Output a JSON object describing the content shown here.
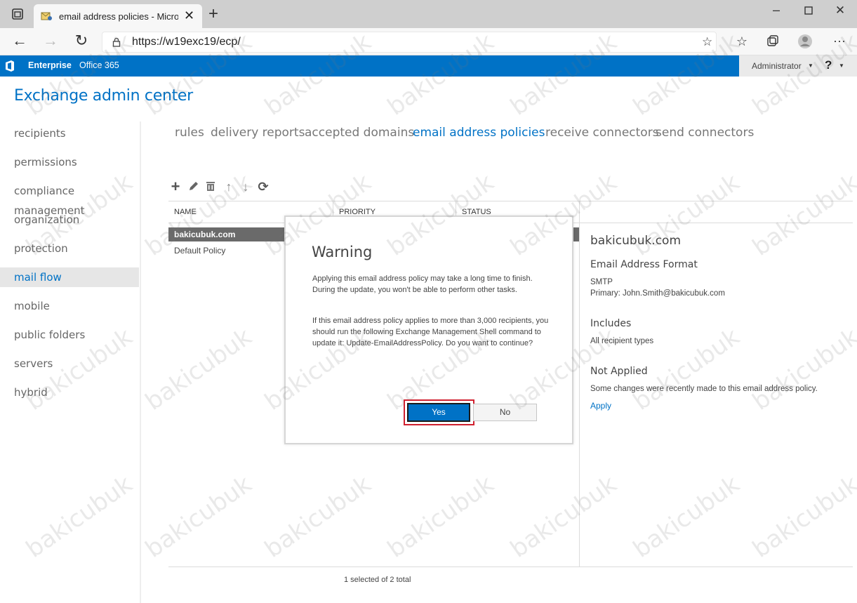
{
  "browser": {
    "tab_title": "email address policies - Microsof",
    "url": "https://w19exc19/ecp/"
  },
  "o365": {
    "enterprise": "Enterprise",
    "office365": "Office 365",
    "user": "Administrator",
    "help": "?"
  },
  "page_title": "Exchange admin center",
  "nav": [
    "recipients",
    "permissions",
    "compliance management",
    "organization",
    "protection",
    "mail flow",
    "mobile",
    "public folders",
    "servers",
    "hybrid"
  ],
  "subtabs": [
    "rules",
    "delivery reports",
    "accepted domains",
    "email address policies",
    "receive connectors",
    "send connectors"
  ],
  "columns": {
    "name": "NAME",
    "priority": "PRIORITY",
    "status": "STATUS"
  },
  "rows": [
    {
      "name": "bakicubuk.com"
    },
    {
      "name": "Default Policy"
    }
  ],
  "footer": "1 selected of 2 total",
  "detail": {
    "title": "bakicubuk.com",
    "format_heading": "Email Address Format",
    "smtp": "SMTP",
    "primary": "Primary: John.Smith@bakicubuk.com",
    "includes_heading": "Includes",
    "includes_value": "All recipient types",
    "not_applied_heading": "Not Applied",
    "not_applied_text": "Some changes were recently made to this email address policy.",
    "apply": "Apply"
  },
  "dialog": {
    "title": "Warning",
    "p1": "Applying this email address policy may take a long time to finish. During the update, you won't be able to perform other tasks.",
    "p2": "If this email address policy applies to more than 3,000 recipients, you should run the following Exchange Management Shell command to update it: Update-EmailAddressPolicy. Do you want to continue?",
    "yes": "Yes",
    "no": "No"
  },
  "watermark": "bakicubuk",
  "colors": {
    "accent": "#0072c6",
    "highlight": "#d0202e",
    "selected_row": "#6a6a6a"
  }
}
